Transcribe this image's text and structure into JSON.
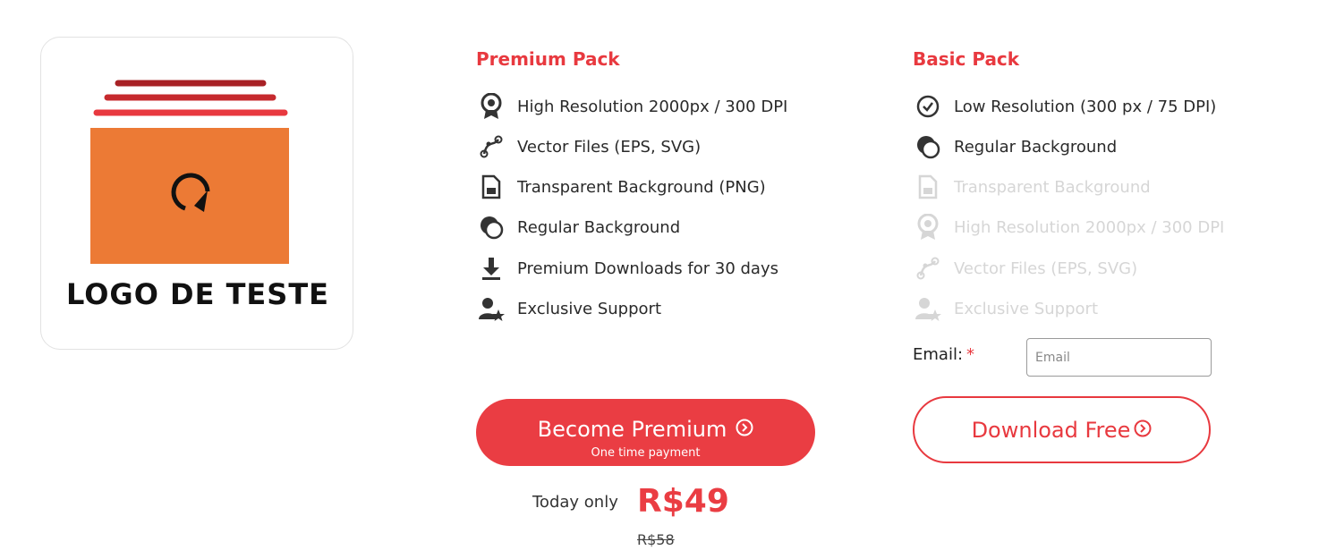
{
  "logo": {
    "name": "LOGO DE TESTE"
  },
  "premium": {
    "title": "Premium Pack",
    "features": [
      {
        "label": "High Resolution 2000px / 300 DPI",
        "icon": "award-ribbon-icon"
      },
      {
        "label": " Vector Files (EPS, SVG)",
        "icon": "vector-path-icon"
      },
      {
        "label": "Transparent Background (PNG)",
        "icon": "file-icon"
      },
      {
        "label": "Regular Background",
        "icon": "layers-circle-icon"
      },
      {
        "label": "Premium Downloads for 30 days",
        "icon": "download-icon"
      },
      {
        "label": "Exclusive Support",
        "icon": "user-star-icon"
      }
    ],
    "button_label": "Become Premium",
    "button_sub": "One time payment",
    "today_only": "Today only",
    "price": "R$49",
    "old_price": "R$58"
  },
  "basic": {
    "title": "Basic Pack",
    "features": [
      {
        "label": "Low Resolution (300 px / 75 DPI)",
        "icon": "check-circle-icon",
        "enabled": true
      },
      {
        "label": "Regular Background",
        "icon": "layers-circle-icon",
        "enabled": true
      },
      {
        "label": "Transparent Background",
        "icon": "file-icon",
        "enabled": false
      },
      {
        "label": "High Resolution 2000px / 300 DPI",
        "icon": "award-ribbon-icon",
        "enabled": false
      },
      {
        "label": " Vector Files (EPS, SVG)",
        "icon": "vector-path-icon",
        "enabled": false
      },
      {
        "label": "Exclusive Support",
        "icon": "user-star-icon",
        "enabled": false
      }
    ],
    "email_label": "Email:",
    "email_required": "*",
    "email_placeholder": "Email",
    "button_label": "Download Free"
  },
  "colors": {
    "accent": "#ea3d43",
    "logo_orange": "#ec7a35",
    "disabled_text": "#d6d6d6"
  }
}
